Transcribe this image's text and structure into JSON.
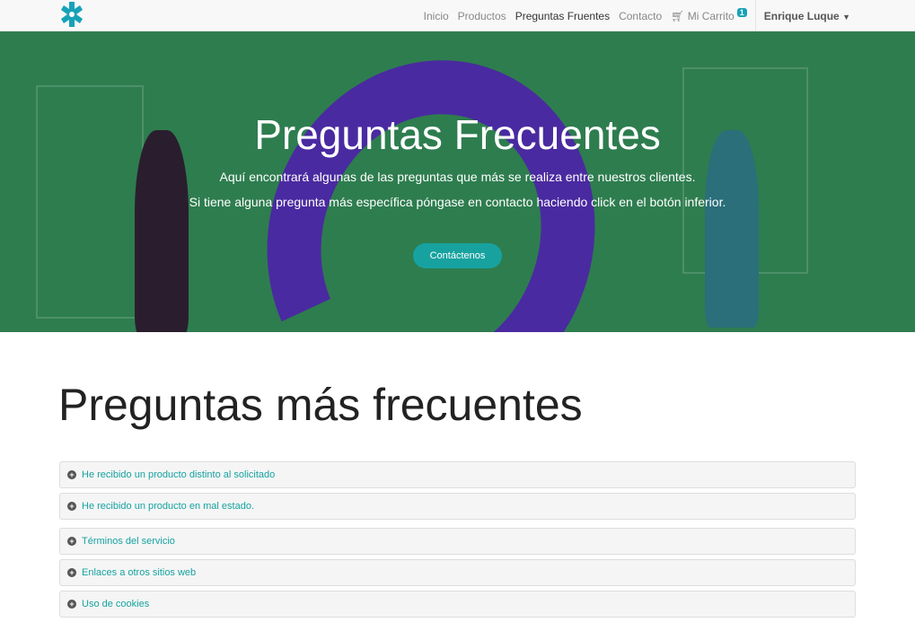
{
  "nav": {
    "items": [
      "Inicio",
      "Productos",
      "Preguntas Fruentes",
      "Contacto"
    ],
    "cart": "Mi Carrito",
    "cart_count": "1",
    "user": "Enrique Luque"
  },
  "hero": {
    "title": "Preguntas Frecuentes",
    "line1": "Aquí encontrará algunas de las preguntas que más se realiza entre nuestros clientes.",
    "line2": "Si tiene alguna pregunta más específica póngase en contacto haciendo click en el botón inferior.",
    "button": "Contáctenos"
  },
  "main": {
    "title": "Preguntas más frecuentes",
    "faq": [
      "He recibido un producto distinto al solicitado",
      "He recibido un producto en mal estado.",
      "Términos del servicio",
      "Enlaces a otros sitios web",
      "Uso de cookies"
    ]
  }
}
